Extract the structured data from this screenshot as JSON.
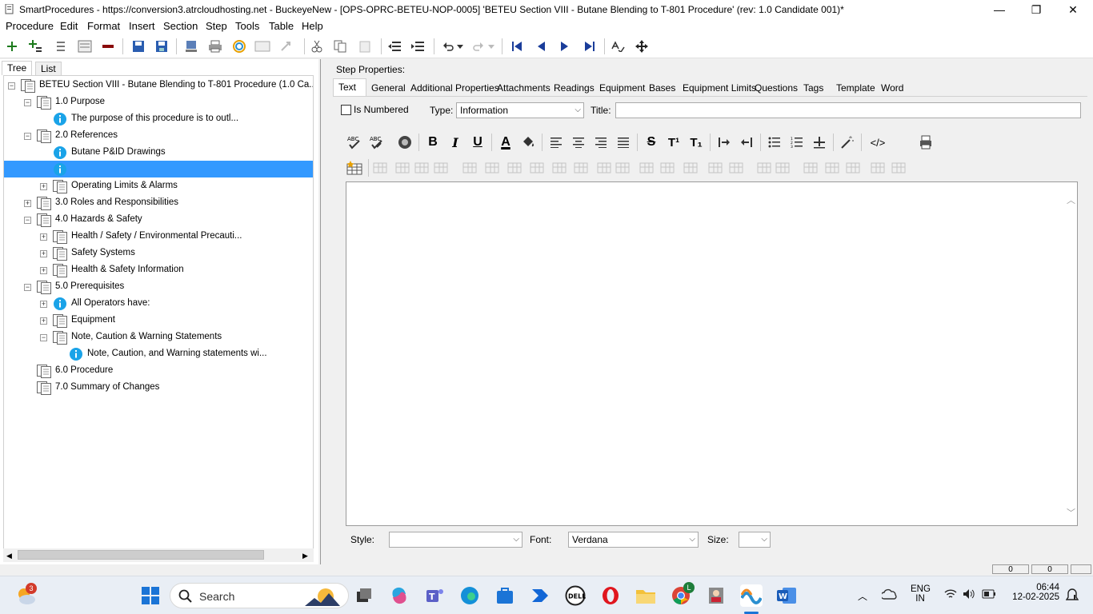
{
  "window": {
    "title": "SmartProcedures - https://conversion3.atrcloudhosting.net - BuckeyeNew - [OPS-OPRC-BETEU-NOP-0005] 'BETEU Section VIII - Butane Blending to T-801 Procedure' (rev: 1.0 Candidate 001)*",
    "minimize": "—",
    "maximize": "❐",
    "close": "✕"
  },
  "menu": [
    "Procedure",
    "Edit",
    "Format",
    "Insert",
    "Section",
    "Step",
    "Tools",
    "Table",
    "Help"
  ],
  "left_tabs": {
    "tree": "Tree",
    "list": "List"
  },
  "tree": [
    {
      "label": "BETEU Section VIII - Butane Blending to T-801 Procedure (1.0 Ca...",
      "type": "section",
      "expander": "−"
    },
    {
      "label": "1.0 Purpose",
      "type": "section",
      "expander": "−"
    },
    {
      "label": "The purpose of this procedure is to outl...",
      "type": "info",
      "expander": ""
    },
    {
      "label": "2.0 References",
      "type": "section",
      "expander": "−"
    },
    {
      "label": "Butane P&ID Drawings",
      "type": "info",
      "expander": ""
    },
    {
      "label": "",
      "type": "info",
      "expander": "",
      "selected": true
    },
    {
      "label": "Operating Limits & Alarms",
      "type": "section",
      "expander": "+"
    },
    {
      "label": "3.0 Roles and Responsibilities",
      "type": "section",
      "expander": "+"
    },
    {
      "label": "4.0 Hazards & Safety",
      "type": "section",
      "expander": "−"
    },
    {
      "label": "Health / Safety / Environmental Precauti...",
      "type": "section",
      "expander": "+"
    },
    {
      "label": "Safety Systems",
      "type": "section",
      "expander": "+"
    },
    {
      "label": "Health & Safety Information",
      "type": "section",
      "expander": "+"
    },
    {
      "label": "5.0 Prerequisites",
      "type": "section",
      "expander": "−"
    },
    {
      "label": "All Operators have:",
      "type": "info",
      "expander": "+"
    },
    {
      "label": "Equipment",
      "type": "section",
      "expander": "+"
    },
    {
      "label": "Note, Caution & Warning Statements",
      "type": "section",
      "expander": "−"
    },
    {
      "label": "Note, Caution, and Warning statements wi...",
      "type": "info",
      "expander": ""
    },
    {
      "label": "6.0 Procedure",
      "type": "section",
      "expander": ""
    },
    {
      "label": "7.0 Summary of Changes",
      "type": "section",
      "expander": ""
    }
  ],
  "step_properties": {
    "heading": "Step Properties:",
    "tabs": [
      "Text",
      "General",
      "Additional Properties",
      "Attachments",
      "Readings",
      "Equipment",
      "Bases",
      "Equipment Limits",
      "Questions",
      "Tags",
      "Template",
      "Word"
    ],
    "is_numbered_label": "Is Numbered",
    "type_label": "Type:",
    "type_value": "Information",
    "title_label": "Title:",
    "title_value": "",
    "style_label": "Style:",
    "style_value": "",
    "font_label": "Font:",
    "font_value": "Verdana",
    "size_label": "Size:",
    "size_value": ""
  },
  "format_glyphs": {
    "bold": "B",
    "italic": "I",
    "underline": "U",
    "font_color": "A",
    "strike": "S",
    "superscript": "T¹",
    "subscript": "T₁",
    "html": "</>"
  },
  "status_values": [
    "0",
    "0"
  ],
  "taskbar": {
    "search": "Search",
    "weather_badge": "3",
    "chrome_badge": "L",
    "lang1": "ENG",
    "lang2": "IN",
    "time": "06:44",
    "date": "12-02-2025"
  }
}
